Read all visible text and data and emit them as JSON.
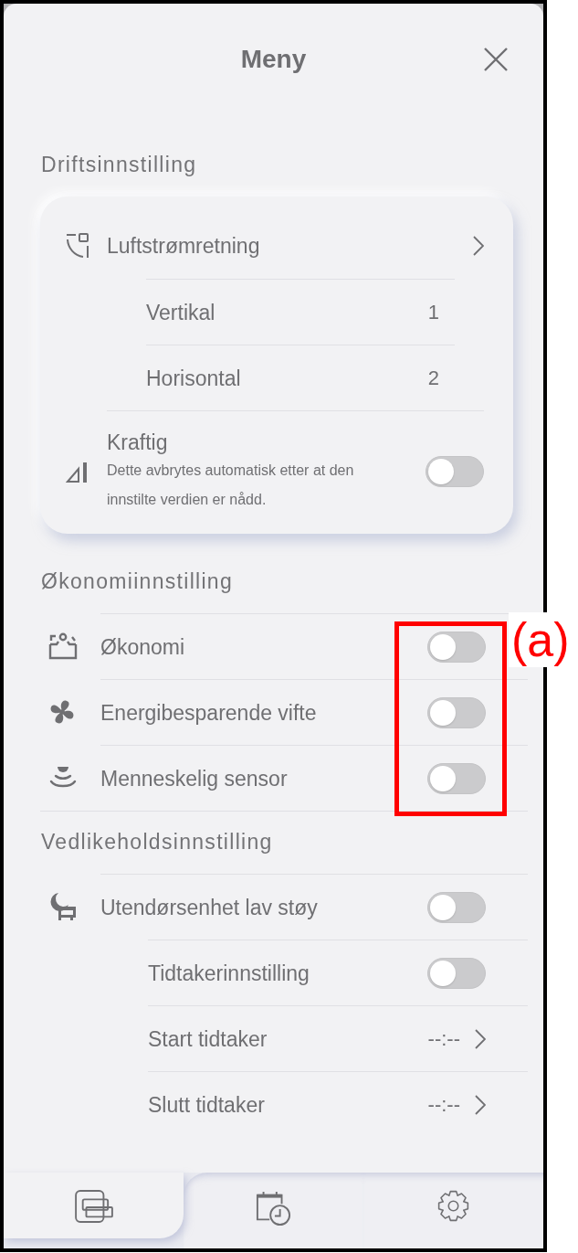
{
  "header": {
    "title": "Meny"
  },
  "sections": [
    {
      "kind": "card",
      "heading": "Driftsinnstilling",
      "items": [
        {
          "kind": "link",
          "label": "Luftstrømretning",
          "children": [
            {
              "kind": "value",
              "label": "Vertikal",
              "value": "1"
            },
            {
              "kind": "value",
              "label": "Horisontal",
              "value": "2"
            }
          ]
        },
        {
          "kind": "toggle",
          "label": "Kraftig",
          "description": "Dette avbrytes automatisk etter at den innstilte verdien er nådd.",
          "on": false
        }
      ]
    },
    {
      "kind": "list",
      "heading": "Økonomiinnstilling",
      "items": [
        {
          "kind": "toggle",
          "label": "Økonomi",
          "on": false
        },
        {
          "kind": "toggle",
          "label": "Energibesparende vifte",
          "on": false
        },
        {
          "kind": "toggle",
          "label": "Menneskelig sensor",
          "on": false
        }
      ]
    },
    {
      "kind": "list",
      "heading": "Vedlikeholdsinnstilling",
      "items": [
        {
          "kind": "toggle",
          "label": "Utendørsenhet lav støy",
          "on": false,
          "children": [
            {
              "kind": "toggle",
              "label": "Tidtakerinnstilling",
              "on": false
            },
            {
              "kind": "link",
              "label": "Start tidtaker",
              "value": "--:--"
            },
            {
              "kind": "link",
              "label": "Slutt tidtaker",
              "value": "--:--"
            }
          ]
        }
      ]
    }
  ],
  "tabs": [
    {
      "selected": true
    },
    {
      "selected": false
    },
    {
      "selected": false
    }
  ],
  "annotation": {
    "label": "(a)"
  }
}
